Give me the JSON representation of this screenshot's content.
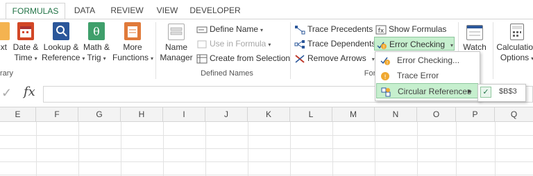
{
  "tabs": [
    {
      "label": "FORMULAS",
      "active": true
    },
    {
      "label": "DATA"
    },
    {
      "label": "REVIEW"
    },
    {
      "label": "VIEW"
    },
    {
      "label": "DEVELOPER"
    }
  ],
  "function_library": {
    "group_label_partial": "rary",
    "buttons": [
      {
        "line1": "ext",
        "line2": "",
        "icon": "text-icon",
        "color": "#f4b350"
      },
      {
        "line1": "Date &",
        "line2": "Time",
        "icon": "calendar-icon",
        "color": "#d24726"
      },
      {
        "line1": "Lookup &",
        "line2": "Reference",
        "icon": "lookup-icon",
        "color": "#2b579a"
      },
      {
        "line1": "Math &",
        "line2": "Trig",
        "icon": "theta-icon",
        "color": "#3f9f6b"
      },
      {
        "line1": "More",
        "line2": "Functions",
        "icon": "more-functions-icon",
        "color": "#e07a3a"
      }
    ]
  },
  "defined_names": {
    "group_label": "Defined Names",
    "name_manager": {
      "line1": "Name",
      "line2": "Manager"
    },
    "define_name": "Define Name",
    "use_in_formula": "Use in Formula",
    "create_from_selection": "Create from Selection"
  },
  "formula_auditing": {
    "group_label_partial": "For",
    "trace_precedents": "Trace Precedents",
    "trace_dependents": "Trace Dependents",
    "remove_arrows": "Remove Arrows",
    "show_formulas": "Show Formulas",
    "error_checking": "Error Checking",
    "watch_window": {
      "line1": "Watch",
      "line2": "ow"
    }
  },
  "calculation": {
    "options": {
      "line1": "Calculation",
      "line2": "Options"
    }
  },
  "error_menu": {
    "items": [
      {
        "label": "Error Checking...",
        "icon": "error-check-icon"
      },
      {
        "label": "Trace Error",
        "icon": "trace-error-icon"
      },
      {
        "label": "Circular References",
        "icon": "circular-ref-icon"
      }
    ],
    "submenu_cell": "$B$3"
  },
  "formula_bar": {
    "fx": "fx",
    "check": "✓"
  },
  "columns": [
    "E",
    "F",
    "G",
    "H",
    "I",
    "J",
    "K",
    "L",
    "M",
    "N",
    "O",
    "P",
    "Q"
  ],
  "colors": {
    "accent": "#217346",
    "selected_bg": "#c6efce"
  }
}
